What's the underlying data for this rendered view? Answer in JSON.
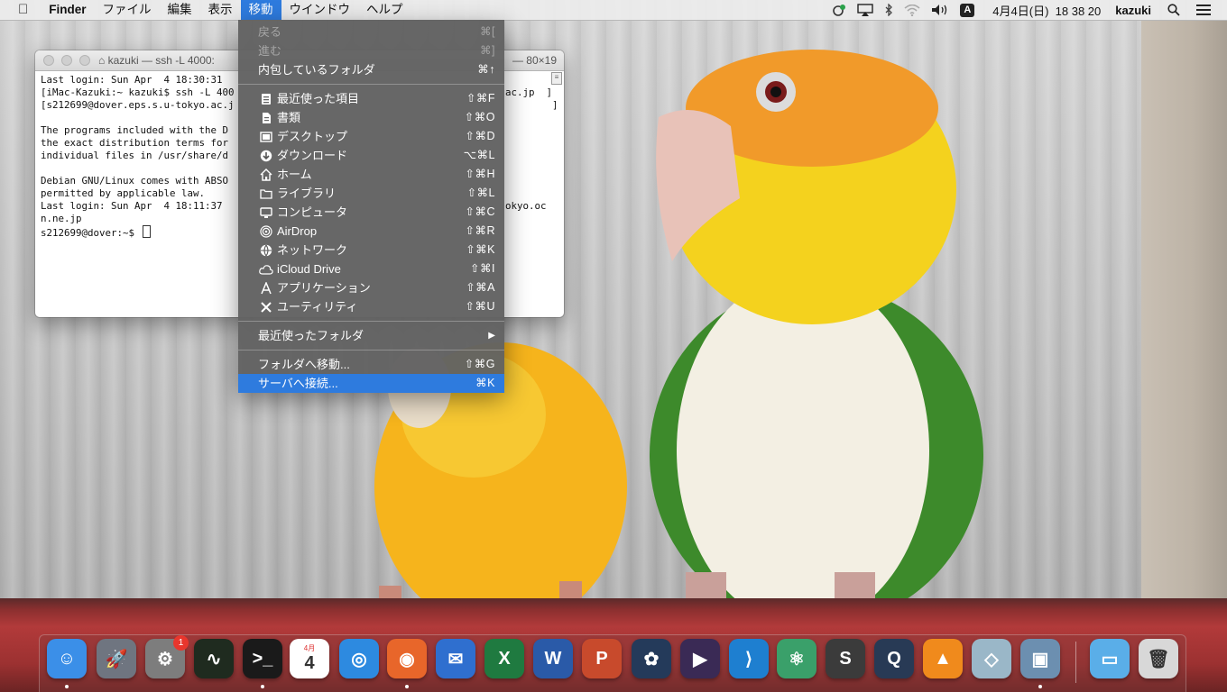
{
  "menubar": {
    "apple": "",
    "app_name": "Finder",
    "menus": [
      "ファイル",
      "編集",
      "表示",
      "移動",
      "ウインドウ",
      "ヘルプ"
    ],
    "active_menu": "移動",
    "status": {
      "input_source": "A",
      "datetime": "4月4日(日)  18 38 20",
      "user": "kazuki"
    }
  },
  "terminal": {
    "title_left": "kazuki — ssh -L 4000:",
    "title_right": "— 80×19",
    "lines": [
      "Last login: Sun Apr  4 18:30:31",
      "[iMac-Kazuki:~ kazuki$ ssh -L 400",
      "[s212699@dover.eps.s.u-tokyo.ac.j",
      "",
      "The programs included with the D",
      "the exact distribution terms for",
      "individual files in /usr/share/d",
      "",
      "Debian GNU/Linux comes with ABSO",
      "permitted by applicable law.",
      "Last login: Sun Apr  4 18:11:37",
      "n.ne.jp",
      "s212699@dover:~$ "
    ],
    "line_tails": {
      "1": "ac.jp  ]",
      "2": "        ]",
      "10": "okyo.oc"
    }
  },
  "go_menu": {
    "items": [
      {
        "label": "戻る",
        "shortcut": "⌘[",
        "disabled": true,
        "icon": ""
      },
      {
        "label": "進む",
        "shortcut": "⌘]",
        "disabled": true,
        "icon": ""
      },
      {
        "label": "内包しているフォルダ",
        "shortcut": "⌘↑",
        "disabled": false,
        "icon": ""
      },
      {
        "label": "最近使った項目",
        "shortcut": "⇧⌘F",
        "icon": "recents-icon"
      },
      {
        "label": "書類",
        "shortcut": "⇧⌘O",
        "icon": "documents-icon"
      },
      {
        "label": "デスクトップ",
        "shortcut": "⇧⌘D",
        "icon": "desktop-icon"
      },
      {
        "label": "ダウンロード",
        "shortcut": "⌥⌘L",
        "icon": "download-icon"
      },
      {
        "label": "ホーム",
        "shortcut": "⇧⌘H",
        "icon": "home-icon"
      },
      {
        "label": "ライブラリ",
        "shortcut": "⇧⌘L",
        "icon": "folder-icon"
      },
      {
        "label": "コンピュータ",
        "shortcut": "⇧⌘C",
        "icon": "computer-icon"
      },
      {
        "label": "AirDrop",
        "shortcut": "⇧⌘R",
        "icon": "airdrop-icon"
      },
      {
        "label": "ネットワーク",
        "shortcut": "⇧⌘K",
        "icon": "network-icon"
      },
      {
        "label": "iCloud Drive",
        "shortcut": "⇧⌘I",
        "icon": "cloud-icon"
      },
      {
        "label": "アプリケーション",
        "shortcut": "⇧⌘A",
        "icon": "applications-icon"
      },
      {
        "label": "ユーティリティ",
        "shortcut": "⇧⌘U",
        "icon": "utilities-icon"
      },
      {
        "label": "最近使ったフォルダ",
        "submenu": true
      },
      {
        "label": "フォルダへ移動...",
        "shortcut": "⇧⌘G"
      },
      {
        "label": "サーバへ接続...",
        "shortcut": "⌘K",
        "selected": true
      }
    ]
  },
  "dock": {
    "apps": [
      {
        "name": "Finder",
        "color": "#3b8fe8",
        "glyph": "☺",
        "running": true
      },
      {
        "name": "Launchpad",
        "color": "#6f7580",
        "glyph": "🚀"
      },
      {
        "name": "System Preferences",
        "color": "#7d7d7d",
        "glyph": "⚙",
        "badge": "1"
      },
      {
        "name": "Activity Monitor",
        "color": "#1f2b1f",
        "glyph": "∿"
      },
      {
        "name": "Terminal",
        "color": "#1a1a1a",
        "glyph": ">_",
        "running": true
      },
      {
        "name": "Calendar",
        "color": "#ffffff",
        "glyph": "4",
        "sub": "4月"
      },
      {
        "name": "Safari",
        "color": "#2d8ae0",
        "glyph": "◎"
      },
      {
        "name": "Firefox",
        "color": "#e8662a",
        "glyph": "◉",
        "running": true
      },
      {
        "name": "Thunderbird",
        "color": "#2f6fcf",
        "glyph": "✉"
      },
      {
        "name": "Excel",
        "color": "#1f7a40",
        "glyph": "X"
      },
      {
        "name": "Word",
        "color": "#2a5aa8",
        "glyph": "W"
      },
      {
        "name": "PowerPoint",
        "color": "#c84a2c",
        "glyph": "P"
      },
      {
        "name": "Photoshop Elements",
        "color": "#243a5a",
        "glyph": "✿"
      },
      {
        "name": "Premiere Elements",
        "color": "#3a2a55",
        "glyph": "▶"
      },
      {
        "name": "VS Code",
        "color": "#1e7fd0",
        "glyph": "⟩"
      },
      {
        "name": "Atom",
        "color": "#3aa06a",
        "glyph": "⚛"
      },
      {
        "name": "Sublime Text",
        "color": "#3b3b3b",
        "glyph": "S"
      },
      {
        "name": "QuickTime",
        "color": "#283a55",
        "glyph": "Q"
      },
      {
        "name": "VLC",
        "color": "#f08a1c",
        "glyph": "▲"
      },
      {
        "name": "Grapher",
        "color": "#9ab7c8",
        "glyph": "◇"
      },
      {
        "name": "Preview",
        "color": "#6c8fb0",
        "glyph": "▣",
        "running": true
      },
      {
        "name": "Downloads",
        "color": "#5aaee8",
        "glyph": "▭"
      },
      {
        "name": "Trash",
        "color": "#d8d8d8",
        "glyph": "🗑"
      }
    ]
  }
}
